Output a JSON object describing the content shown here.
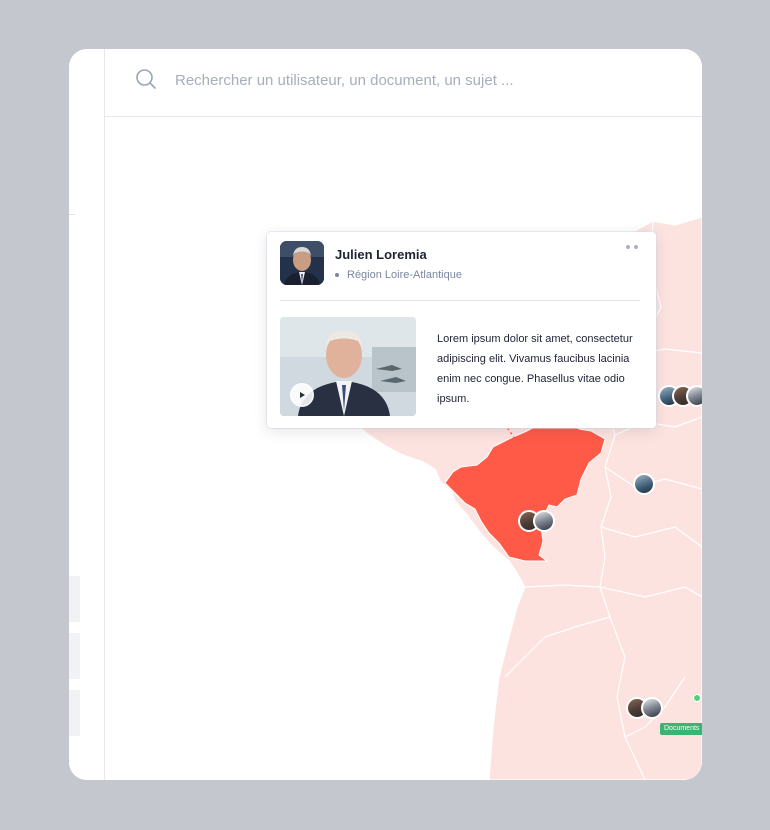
{
  "search": {
    "placeholder": "Rechercher un utilisateur, un document, un sujet ..."
  },
  "profile_card": {
    "name": "Julien Loremia",
    "region": "Région Loire-Atlantique",
    "description": "Lorem ipsum dolor sit amet, consectetur adipiscing elit. Vivamus faucibus lacinia enim nec congue. Phasellus vitae odio ipsum.",
    "more_icon": "more-dots-icon",
    "video_icon": "play-icon"
  },
  "map": {
    "badge_label": "Documents",
    "colors": {
      "highlight_region": "#ff5a47",
      "base_region": "#fde3df",
      "border": "#ffffff",
      "badge": "#3cb371"
    }
  }
}
